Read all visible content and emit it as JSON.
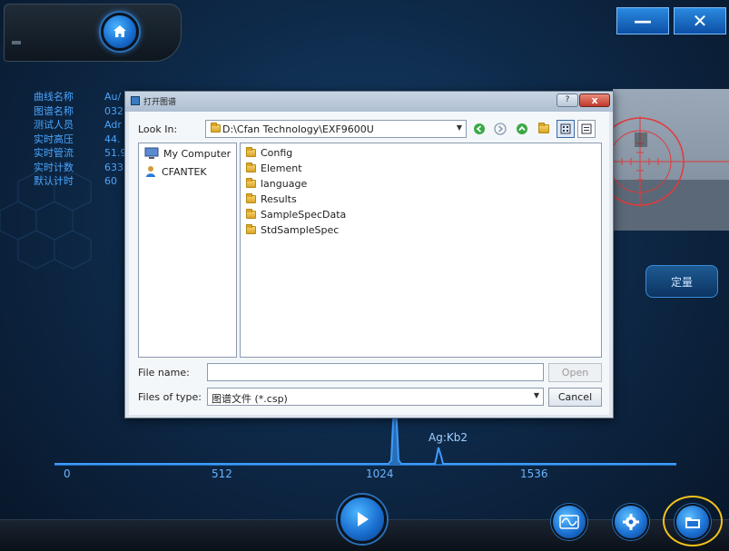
{
  "app": {
    "info_labels": [
      "曲线名称",
      "图谱名称",
      "测试人员",
      "实时高压",
      "实时管流",
      "实时计数",
      "默认计时"
    ],
    "info_values": [
      "Au/",
      "032",
      "Adr",
      "44.",
      "51.9",
      "633",
      "60"
    ],
    "quant_button": "定量",
    "minimize_symbol": "—",
    "close_symbol": "✕"
  },
  "spectrum": {
    "axis_ticks": [
      "0",
      "512",
      "1024",
      "1536"
    ],
    "peak_label": "Ag:Kb2"
  },
  "dialog": {
    "title": "打开图谱",
    "help_label": "?",
    "close_symbol": "x",
    "look_in_label": "Look In:",
    "look_in_path": "D:\\Cfan Technology\\EXF9600U",
    "places": [
      {
        "label": "My Computer",
        "icon": "computer-icon"
      },
      {
        "label": "CFANTEK",
        "icon": "user-icon"
      }
    ],
    "files": [
      "Config",
      "Element",
      "language",
      "Results",
      "SampleSpecData",
      "StdSampleSpec"
    ],
    "file_name_label": "File name:",
    "file_name_value": "",
    "open_button": "Open",
    "files_of_type_label": "Files of type:",
    "files_of_type_value": "图谱文件 (*.csp)",
    "cancel_button": "Cancel"
  },
  "colors": {
    "accent": "#1a6fd0",
    "info_text": "#4aa6ff",
    "highlight_ring": "#f4c21a"
  }
}
